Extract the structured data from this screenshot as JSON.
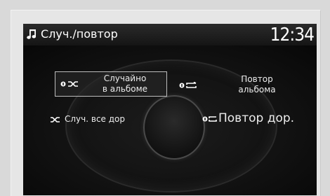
{
  "header": {
    "icon": "music-note-icon",
    "title": "Случ./повтор",
    "clock": "12:34"
  },
  "options": {
    "album_shuffle": {
      "label_line1": "Случайно",
      "label_line2": "в альбоме",
      "icon": "shuffle-one-icon",
      "selected": true
    },
    "album_repeat": {
      "label_line1": "Повтор",
      "label_line2": "альбома",
      "icon": "repeat-one-icon"
    },
    "all_shuffle": {
      "label": "Случ. все дор",
      "icon": "shuffle-all-icon"
    },
    "track_repeat": {
      "label": "Повтор дор.",
      "icon": "repeat-track-icon"
    }
  },
  "colors": {
    "screen_bg": "#0a0a0a",
    "text": "#ececec",
    "selection_border": "#bdbdbd"
  }
}
